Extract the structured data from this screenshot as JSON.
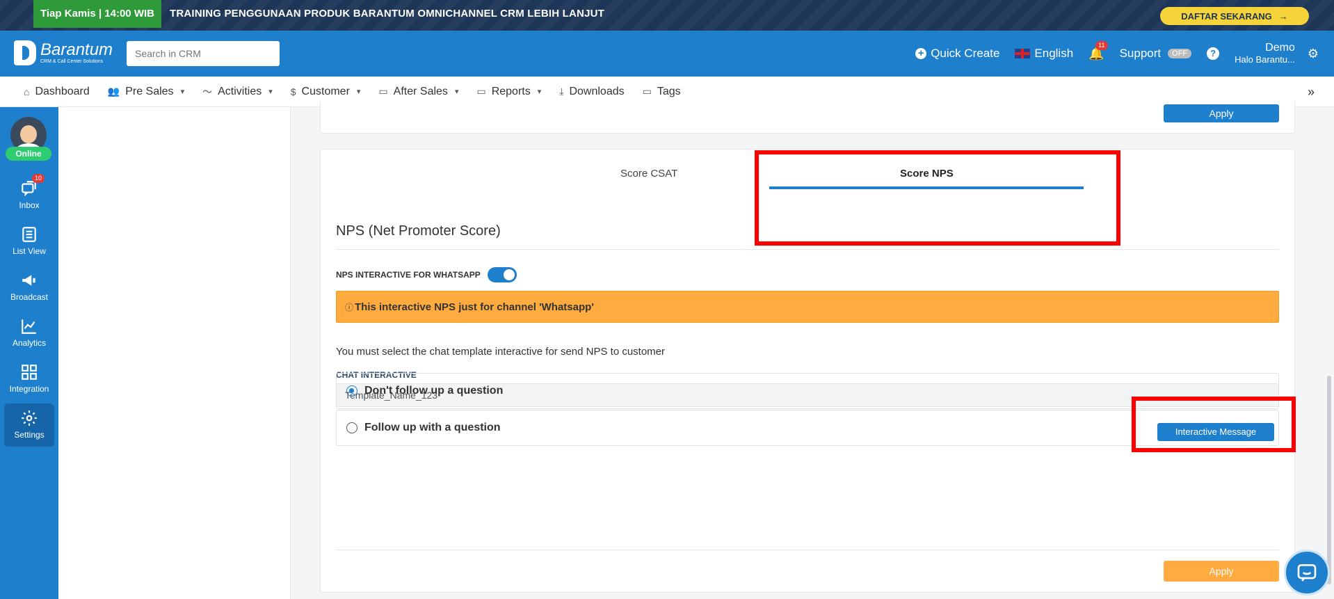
{
  "promo": {
    "date": "Tiap Kamis | 14:00 WIB",
    "text": "TRAINING PENGGUNAAN PRODUK BARANTUM OMNICHANNEL CRM LEBIH LANJUT",
    "button": "DAFTAR SEKARANG"
  },
  "header": {
    "brand": "Barantum",
    "brand_sub": "CRM & Call Center Solutions",
    "search_placeholder": "Search in CRM",
    "quick_create": "Quick Create",
    "language": "English",
    "notif_count": "11",
    "support": "Support",
    "support_state": "OFF",
    "user_name": "Demo",
    "user_sub": "Halo Barantu..."
  },
  "nav": {
    "items": [
      {
        "label": "Dashboard"
      },
      {
        "label": "Pre Sales"
      },
      {
        "label": "Activities"
      },
      {
        "label": "Customer"
      },
      {
        "label": "After Sales"
      },
      {
        "label": "Reports"
      },
      {
        "label": "Downloads"
      },
      {
        "label": "Tags"
      }
    ]
  },
  "sidebar": {
    "status": "Online",
    "inbox_count": "10",
    "items": [
      {
        "label": "Inbox"
      },
      {
        "label": "List View"
      },
      {
        "label": "Broadcast"
      },
      {
        "label": "Analytics"
      },
      {
        "label": "Integration"
      },
      {
        "label": "Settings"
      }
    ]
  },
  "top_card": {
    "apply": "Apply"
  },
  "nps": {
    "tabs": [
      {
        "label": "Score CSAT"
      },
      {
        "label": "Score NPS"
      }
    ],
    "title": "NPS (Net Promoter Score)",
    "toggle_label": "NPS INTERACTIVE FOR WHATSAPP",
    "warning_icon": "ⓘ",
    "warning": "This interactive NPS just for channel 'Whatsapp'",
    "note": "You must select the chat template interactive for send NPS to customer",
    "chat_label": "CHAT INTERACTIVE",
    "chat_value": "Template_Name_123",
    "interactive_button": "Interactive Message",
    "options": [
      {
        "label": "Don't follow up a question"
      },
      {
        "label": "Follow up with a question"
      }
    ],
    "apply": "Apply"
  },
  "colors": {
    "primary": "#1e7fcc",
    "warning": "#ffab40",
    "highlight": "#ff0000"
  }
}
